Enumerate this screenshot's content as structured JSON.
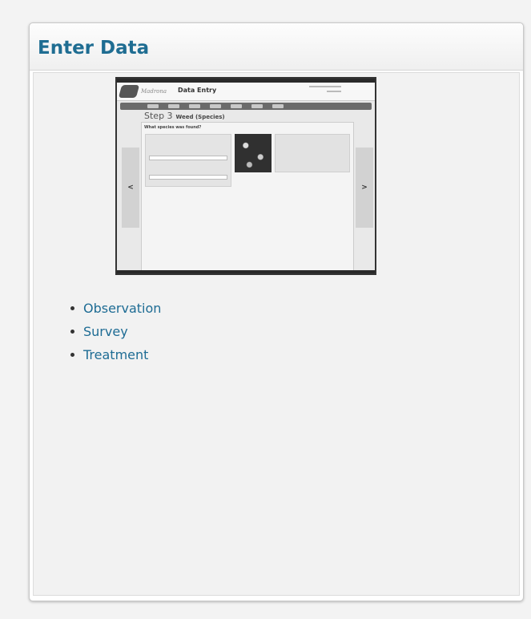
{
  "panel": {
    "title": "Enter Data"
  },
  "preview": {
    "app_name": "Madrona",
    "page_heading": "Data Entry",
    "step_label": "Step 3",
    "step_title": "Weed (Species)",
    "card_title": "What species was found?",
    "prev_label": "<",
    "next_label": ">"
  },
  "links": [
    {
      "label": "Observation"
    },
    {
      "label": "Survey"
    },
    {
      "label": "Treatment"
    }
  ],
  "colors": {
    "title": "#1f6d92",
    "link": "#1e6c94"
  }
}
